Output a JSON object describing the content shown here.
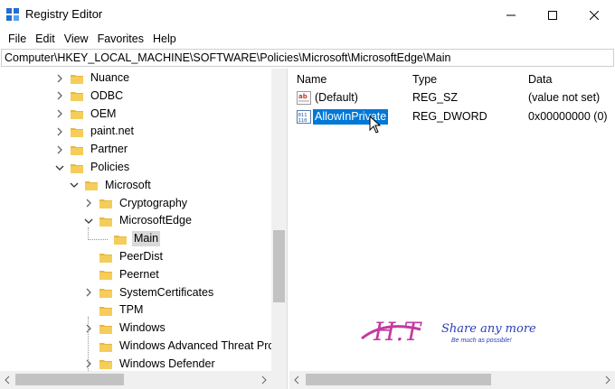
{
  "window": {
    "title": "Registry Editor"
  },
  "menu": [
    "File",
    "Edit",
    "View",
    "Favorites",
    "Help"
  ],
  "address": "Computer\\HKEY_LOCAL_MACHINE\\SOFTWARE\\Policies\\Microsoft\\MicrosoftEdge\\Main",
  "tree": [
    {
      "label": "Nuance",
      "expanded": false
    },
    {
      "label": "ODBC",
      "expanded": false
    },
    {
      "label": "OEM",
      "expanded": false
    },
    {
      "label": "paint.net",
      "expanded": false
    },
    {
      "label": "Partner",
      "expanded": false
    },
    {
      "label": "Policies",
      "expanded": true
    },
    {
      "label": "Microsoft",
      "expanded": true
    },
    {
      "label": "Cryptography",
      "expanded": false
    },
    {
      "label": "MicrosoftEdge",
      "expanded": true
    },
    {
      "label": "Main",
      "selected": true
    },
    {
      "label": "PeerDist"
    },
    {
      "label": "Peernet"
    },
    {
      "label": "SystemCertificates",
      "expanded": false
    },
    {
      "label": "TPM"
    },
    {
      "label": "Windows",
      "expanded": false
    },
    {
      "label": "Windows Advanced Threat Pro"
    },
    {
      "label": "Windows Defender",
      "expanded": false
    }
  ],
  "columns": {
    "name": "Name",
    "type": "Type",
    "data": "Data"
  },
  "values": [
    {
      "name": "(Default)",
      "type": "REG_SZ",
      "data": "(value not set)",
      "icon": "string-value-icon"
    },
    {
      "name": "AllowInPrivate",
      "type": "REG_DWORD",
      "data": "0x00000000 (0)",
      "icon": "dword-value-icon",
      "selected": true
    }
  ],
  "watermark": {
    "line1": "Share any more",
    "line2": "Be much as possible!",
    "logo": "H.T"
  },
  "colors": {
    "selection": "#0078d7",
    "folder": "#e8b73c"
  }
}
